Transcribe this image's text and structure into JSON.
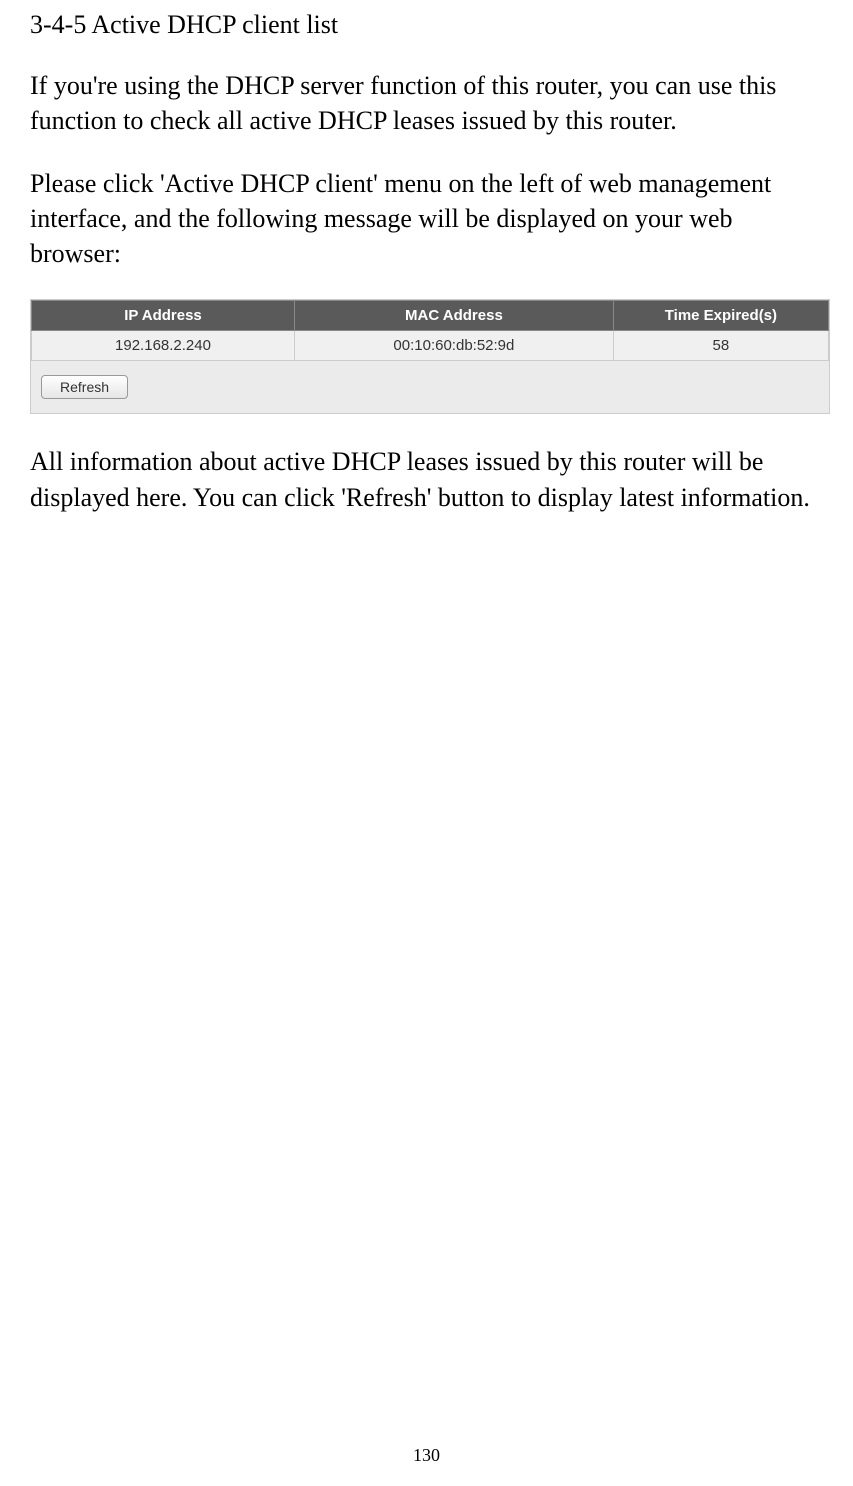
{
  "heading": "3-4-5 Active DHCP client list",
  "para1": "If you're using the DHCP server function of this router, you can use this function to check all active DHCP leases issued by this router.",
  "para2": "Please click 'Active DHCP client' menu on the left of web management interface, and the following message will be displayed on your web browser:",
  "para3": "All information about active DHCP leases issued by this router will be displayed here. You can click 'Refresh' button to display latest information.",
  "table": {
    "headers": {
      "ip": "IP Address",
      "mac": "MAC Address",
      "time": "Time Expired(s)"
    },
    "row": {
      "ip": "192.168.2.240",
      "mac": "00:10:60:db:52:9d",
      "time": "58"
    }
  },
  "refresh_label": "Refresh",
  "page_number": "130"
}
